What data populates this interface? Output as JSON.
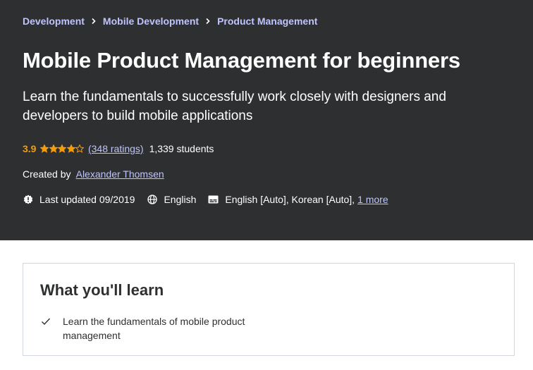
{
  "breadcrumb": {
    "items": [
      "Development",
      "Mobile Development",
      "Product Management"
    ]
  },
  "course": {
    "title": "Mobile Product Management for beginners",
    "subtitle": "Learn the fundamentals to successfully work closely with designers and developers to build mobile applications",
    "rating": "3.9",
    "rating_stars": 3.9,
    "ratings_link": "(348 ratings)",
    "students": "1,339 students",
    "created_by_label": "Created by",
    "instructor": "Alexander Thomsen",
    "last_updated": "Last updated 09/2019",
    "language": "English",
    "captions": "English [Auto], Korean [Auto],",
    "captions_more": "1 more"
  },
  "icons": {
    "last_updated": "alert-badge-icon",
    "language": "globe-icon",
    "captions": "closed-caption-icon",
    "learn_item": "checkmark-icon",
    "breadcrumb_separator": "chevron-right-icon",
    "star": "star-icon"
  },
  "colors": {
    "hero_bg": "#2d2f31",
    "link": "#c0c4fc",
    "rating": "#f69c08",
    "text_dark": "#2d2f31"
  },
  "learn": {
    "title": "What you'll learn",
    "items": [
      "Learn the fundamentals of mobile product management"
    ]
  }
}
